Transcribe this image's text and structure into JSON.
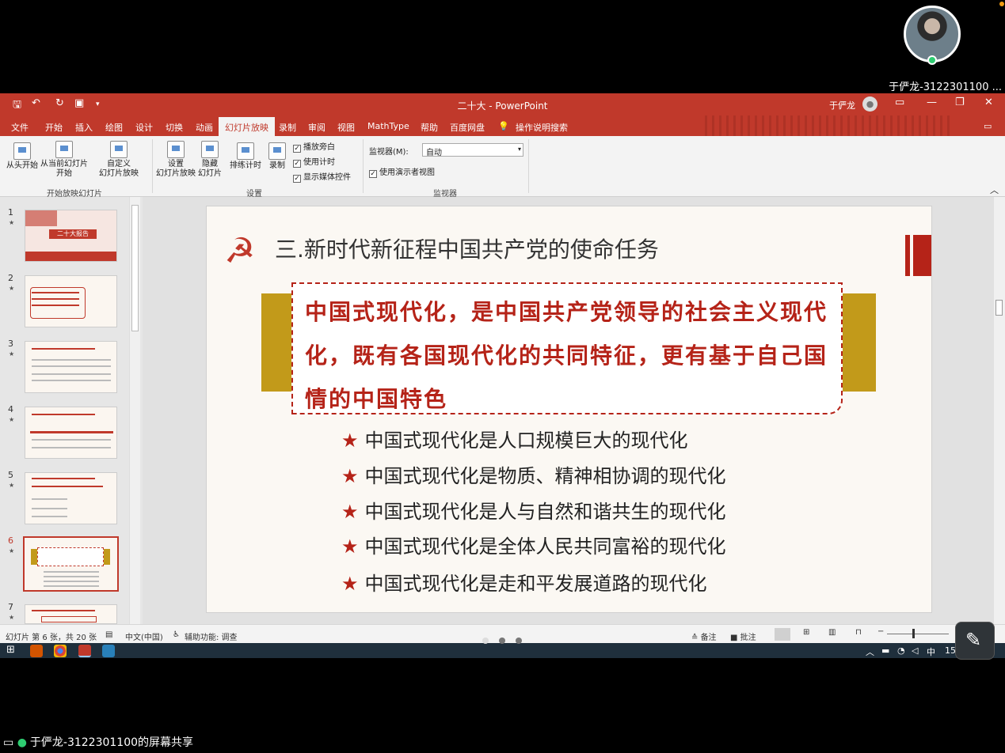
{
  "meeting": {
    "participant_label": "于俨龙-3122301100 ...",
    "share_caption": "于俨龙-3122301100的屏幕共享"
  },
  "window": {
    "title": "二十大 - PowerPoint",
    "user": "于俨龙"
  },
  "tabs": [
    "文件",
    "开始",
    "插入",
    "绘图",
    "设计",
    "切换",
    "动画",
    "幻灯片放映",
    "录制",
    "审阅",
    "视图",
    "MathType",
    "帮助",
    "百度网盘"
  ],
  "active_tab": "幻灯片放映",
  "tell_me": "操作说明搜索",
  "ribbon": {
    "from_beginning": "从头开始",
    "from_current_1": "从当前幻灯片",
    "from_current_2": "开始",
    "custom_1": "自定义",
    "custom_2": "幻灯片放映",
    "group_start": "开始放映幻灯片",
    "setup_1": "设置",
    "setup_2": "幻灯片放映",
    "hide_1": "隐藏",
    "hide_2": "幻灯片",
    "rehearse": "排练计时",
    "record": "录制",
    "chk_narration": "播放旁白",
    "chk_timing": "使用计时",
    "chk_media": "显示媒体控件",
    "group_setup": "设置",
    "monitor_label": "监视器(M):",
    "monitor_value": "自动",
    "chk_presenter": "使用演示者视图",
    "group_monitor": "监视器"
  },
  "thumbnails": [
    {
      "num": "1",
      "title": "二十大报告"
    },
    {
      "num": "2",
      "title": ""
    },
    {
      "num": "3",
      "title": ""
    },
    {
      "num": "4",
      "title": ""
    },
    {
      "num": "5",
      "title": ""
    },
    {
      "num": "6",
      "title": ""
    },
    {
      "num": "7",
      "title": ""
    }
  ],
  "selected_slide": 6,
  "slide": {
    "title": "三.新时代新征程中国共产党的使命任务",
    "callout": "中国式现代化，是中国共产党领导的社会主义现代化，既有各国现代化的共同特征，更有基于自己国情的中国特色",
    "bullets": [
      "中国式现代化是人口规模巨大的现代化",
      "中国式现代化是物质、精神相协调的现代化",
      "中国式现代化是人与自然和谐共生的现代化",
      "中国式现代化是全体人民共同富裕的现代化",
      "中国式现代化是走和平发展道路的现代化"
    ]
  },
  "status": {
    "slide_info": "幻灯片 第 6 张，共 20 张",
    "language": "中文(中国)",
    "accessibility": "辅助功能: 调查",
    "notes": "备注",
    "comments": "批注"
  },
  "tray": {
    "ime": "中",
    "clock": "15:1"
  },
  "colors": {
    "accent": "#c0392b",
    "slide_red": "#b52318",
    "gold": "#c29a1a"
  }
}
